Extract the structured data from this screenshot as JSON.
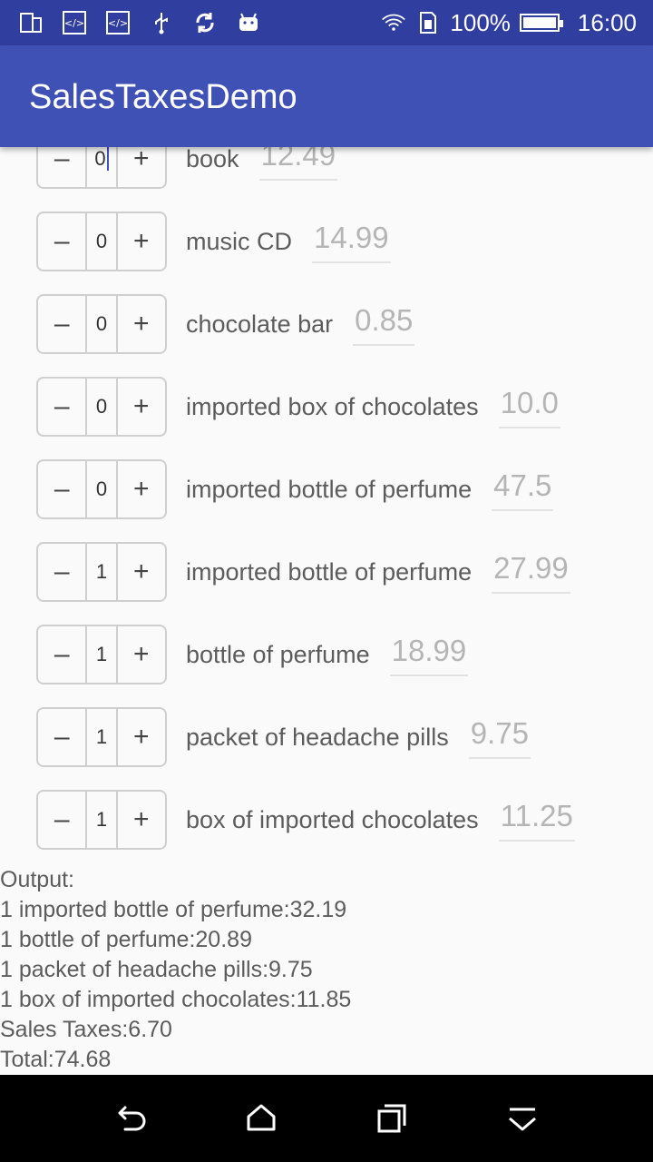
{
  "status_bar": {
    "battery_percent": "100%",
    "battery_level": 1.0,
    "time": "16:00",
    "left_icons": [
      "screenshot-icon",
      "code-icon",
      "code-icon",
      "usb-icon",
      "sync-icon",
      "android-icon"
    ],
    "right_icons": [
      "wifi-icon",
      "sim-icon",
      "battery-icon"
    ]
  },
  "app_bar": {
    "title": "SalesTaxesDemo"
  },
  "stepper": {
    "minus": "–",
    "plus": "+"
  },
  "items": [
    {
      "qty": "0",
      "name": "book",
      "price": "12.49"
    },
    {
      "qty": "0",
      "name": "music CD",
      "price": "14.99"
    },
    {
      "qty": "0",
      "name": "chocolate bar",
      "price": "0.85"
    },
    {
      "qty": "0",
      "name": "imported box of chocolates",
      "price": "10.0"
    },
    {
      "qty": "0",
      "name": "imported bottle of perfume",
      "price": "47.5"
    },
    {
      "qty": "1",
      "name": "imported bottle of perfume",
      "price": "27.99"
    },
    {
      "qty": "1",
      "name": "bottle of perfume",
      "price": "18.99"
    },
    {
      "qty": "1",
      "name": "packet of headache pills",
      "price": "9.75"
    },
    {
      "qty": "1",
      "name": "box of imported chocolates",
      "price": "11.25"
    }
  ],
  "output": {
    "lines": [
      "Output:",
      "1 imported bottle of perfume:32.19",
      "1 bottle of perfume:20.89",
      "1 packet of headache pills:9.75",
      "1 box of imported chocolates:11.85",
      "Sales Taxes:6.70",
      "Total:74.68"
    ]
  },
  "nav_bar": {
    "buttons": [
      "back-icon",
      "home-icon",
      "recents-icon",
      "hide-keyboard-icon"
    ]
  },
  "colors": {
    "status_bar": "#303f9f",
    "app_bar": "#3f51b5",
    "background": "#fafafa"
  }
}
